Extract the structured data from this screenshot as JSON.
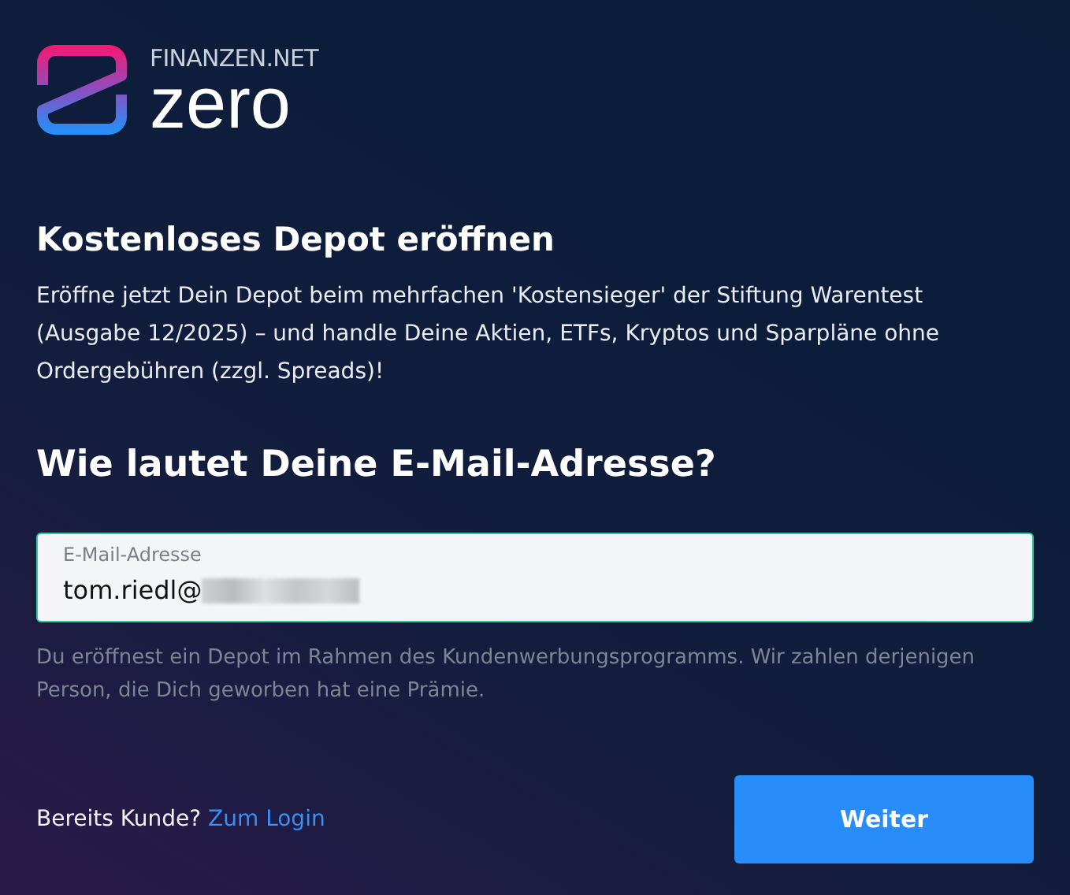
{
  "logo": {
    "brand": "FINANZEN.NET",
    "product": "zero"
  },
  "title": "Kostenloses Depot eröffnen",
  "intro": "Eröffne jetzt Dein Depot beim mehrfachen 'Kostensieger' der Stiftung Warentest (Ausgabe 12/2025) – und handle Deine Aktien, ETFs, Kryptos und Sparpläne ohne Ordergebühren (zzgl. Spreads)!",
  "question": "Wie lautet Deine E-Mail-Adresse?",
  "email_field": {
    "label": "E-Mail-Adresse",
    "value": "tom.riedl@",
    "redacted": true,
    "focused": true
  },
  "hint": "Du eröffnest ein Depot im Rahmen des Kundenwerbungsprogramms. Wir zahlen derjenigen Person, die Dich geworben hat eine Prämie.",
  "footer": {
    "prompt": "Bereits Kunde?",
    "link": "Zum Login"
  },
  "buttons": [
    "Weiter"
  ]
}
